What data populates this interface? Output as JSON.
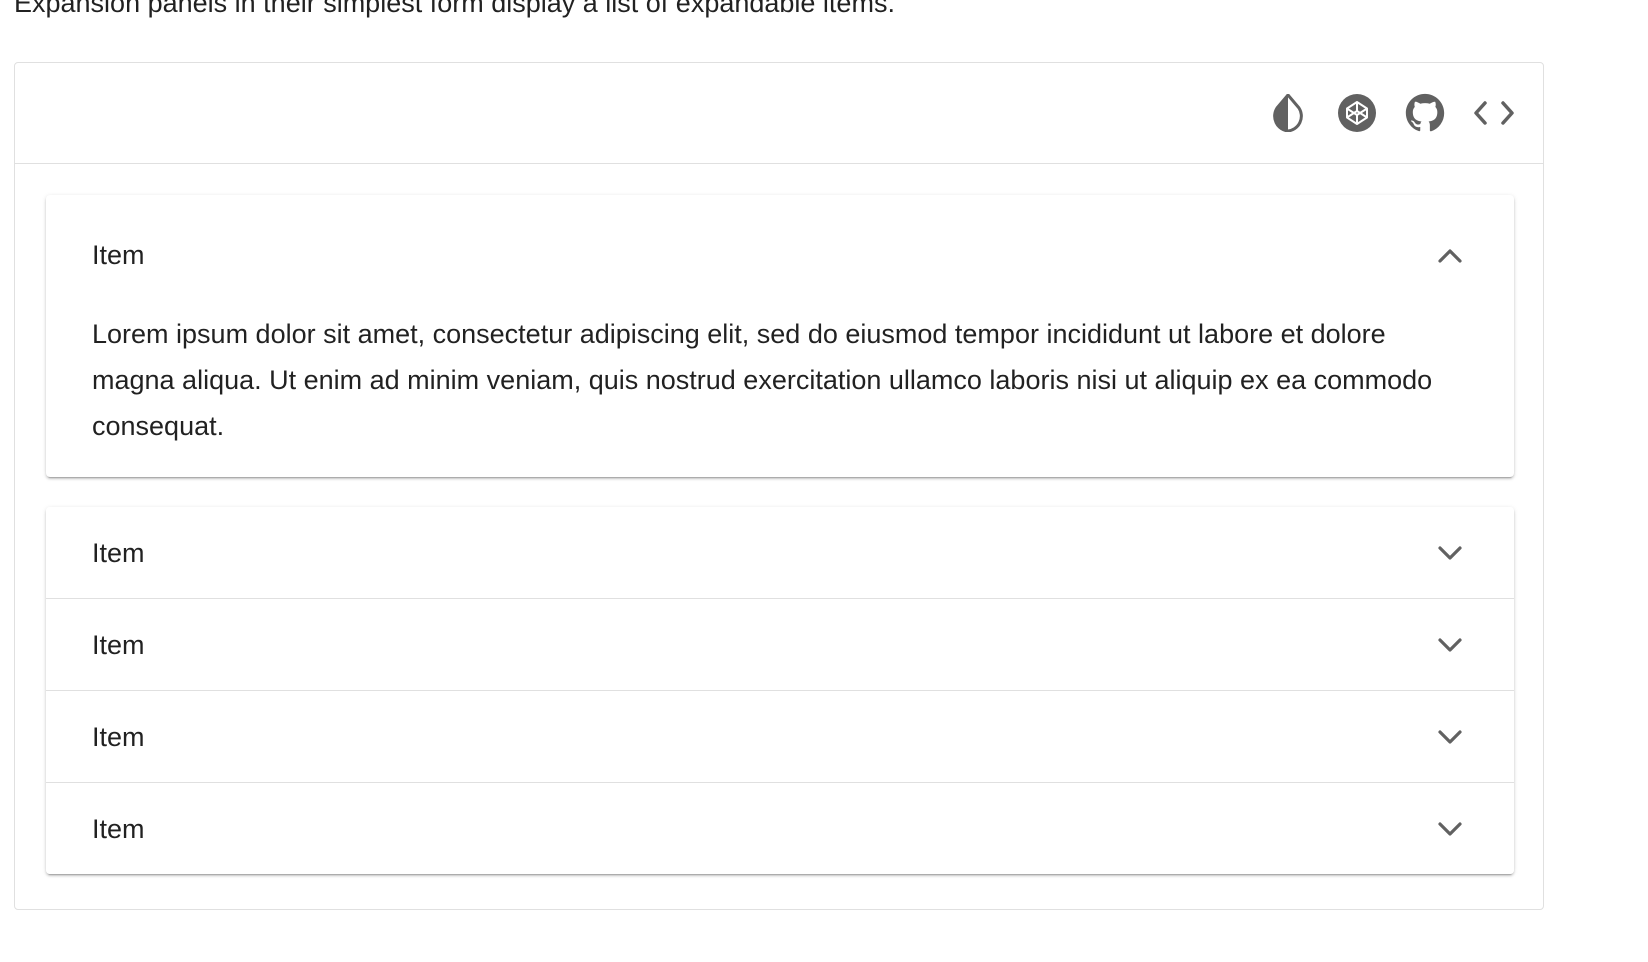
{
  "intro_text": "Expansion panels in their simplest form display a list of expandable items.",
  "toolbar": {
    "buttons": [
      {
        "icon": "invert-colors-icon"
      },
      {
        "icon": "codepen-icon"
      },
      {
        "icon": "github-icon"
      },
      {
        "icon": "code-icon"
      }
    ]
  },
  "panels": [
    {
      "title": "Item",
      "expanded": true,
      "content": "Lorem ipsum dolor sit amet, consectetur adipiscing elit, sed do eiusmod tempor incididunt ut labore et dolore magna aliqua. Ut enim ad minim veniam, quis nostrud exercitation ullamco laboris nisi ut aliquip ex ea commodo consequat."
    },
    {
      "title": "Item",
      "expanded": false
    },
    {
      "title": "Item",
      "expanded": false
    },
    {
      "title": "Item",
      "expanded": false
    },
    {
      "title": "Item",
      "expanded": false
    }
  ],
  "colors": {
    "icon": "#616161",
    "text": "#212121",
    "divider": "#e0e0e0"
  }
}
